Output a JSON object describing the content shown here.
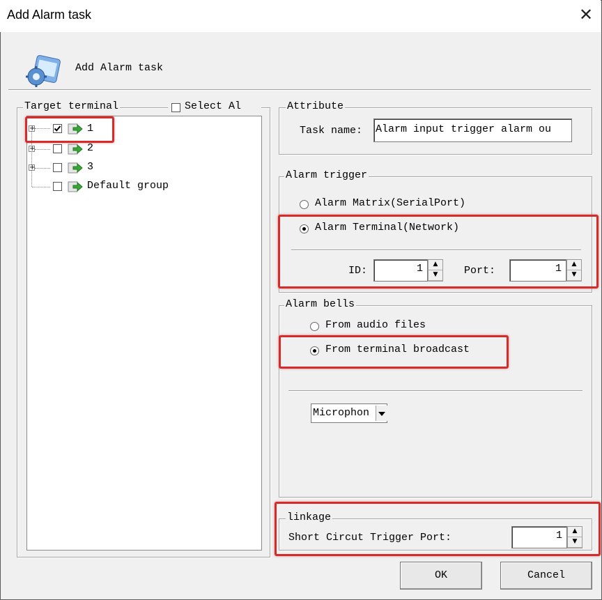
{
  "window": {
    "title": "Add Alarm task",
    "close_glyph": "✕"
  },
  "header": {
    "title": "Add Alarm task",
    "icon": "settings-gear-icon"
  },
  "target_terminal": {
    "label": "Target terminal",
    "select_all_label": "Select Al",
    "select_all_checked": false,
    "items": [
      {
        "label": "1",
        "checked": true,
        "expandable": true
      },
      {
        "label": "2",
        "checked": false,
        "expandable": true
      },
      {
        "label": "3",
        "checked": false,
        "expandable": true
      },
      {
        "label": "Default group",
        "checked": false,
        "expandable": false
      }
    ]
  },
  "attribute": {
    "label": "Attribute",
    "task_name_label": "Task name:",
    "task_name_value": "Alarm input trigger alarm ou"
  },
  "alarm_trigger": {
    "label": "Alarm trigger",
    "option_matrix": "Alarm Matrix(SerialPort)",
    "option_terminal": "Alarm Terminal(Network)",
    "selected": "terminal",
    "id_label": "ID:",
    "id_value": "1",
    "port_label": "Port:",
    "port_value": "1"
  },
  "alarm_bells": {
    "label": "Alarm bells",
    "option_audio": "From audio files",
    "option_broadcast": "From terminal broadcast",
    "selected": "broadcast",
    "source_value": "Microphon"
  },
  "linkage": {
    "label": "linkage",
    "port_label": "Short Circut Trigger Port:",
    "port_value": "1"
  },
  "buttons": {
    "ok": "OK",
    "cancel": "Cancel"
  },
  "colors": {
    "highlight": "#d52b2b",
    "arrow_green": "#3aa63a",
    "dialog_bg": "#f0f0f0"
  }
}
